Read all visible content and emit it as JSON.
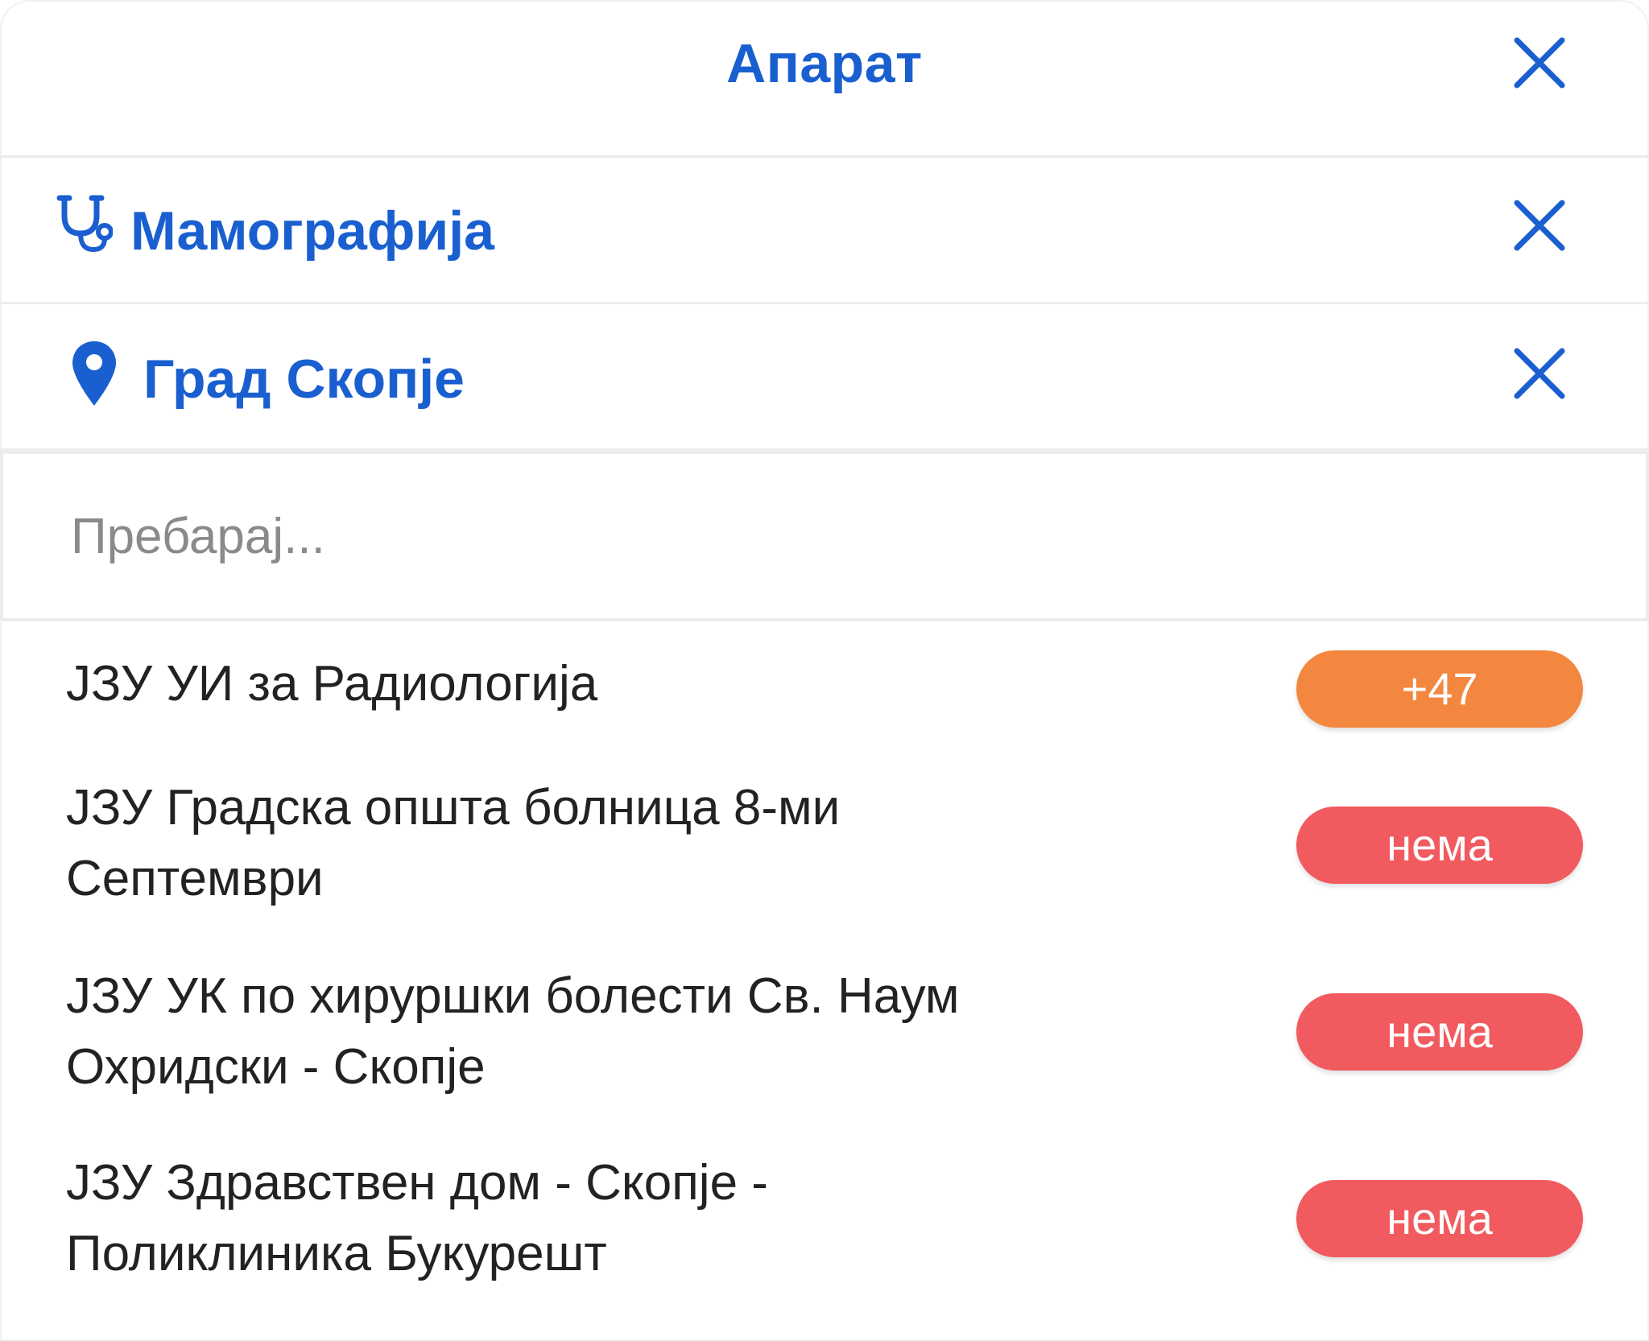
{
  "header": {
    "title": "Апарат"
  },
  "filters": [
    {
      "label": "Мамографија",
      "icon": "stethoscope-icon"
    },
    {
      "label": "Град Скопје",
      "icon": "map-pin-icon"
    }
  ],
  "search": {
    "placeholder": "Пребарај..."
  },
  "colors": {
    "accent": "#1a5fcf",
    "badge_available": "#f3873f",
    "badge_none": "#f15a5f"
  },
  "results": [
    {
      "line1": "ЈЗУ УИ за Радиологија",
      "line2": "",
      "badge": "+47",
      "status": "available"
    },
    {
      "line1": "ЈЗУ Градска општа болница 8-ми",
      "line2": "Септември",
      "badge": "нема",
      "status": "none"
    },
    {
      "line1": "ЈЗУ УК по хируршки болести Св. Наум",
      "line2": "Охридски - Скопје",
      "badge": "нема",
      "status": "none"
    },
    {
      "line1": "ЈЗУ Здравствен дом - Скопје -",
      "line2": "Поликлиника Букурешт",
      "badge": "нема",
      "status": "none"
    }
  ]
}
